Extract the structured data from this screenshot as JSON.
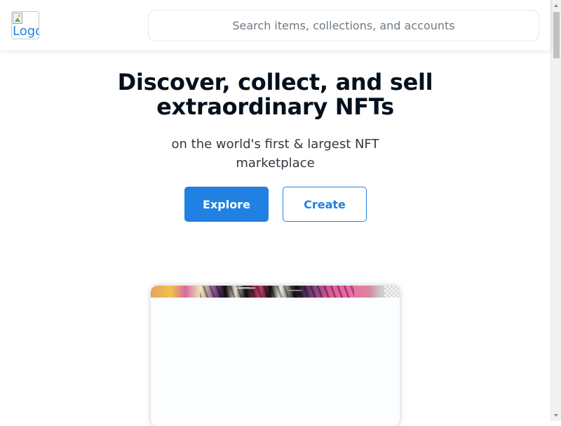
{
  "header": {
    "logo_alt": "Logo",
    "search": {
      "placeholder": "Search items, collections, and accounts",
      "value": ""
    }
  },
  "hero": {
    "headline": "Discover, collect, and sell extraordinary NFTs",
    "subhead": "on the world's first & largest NFT marketplace",
    "explore_label": "Explore",
    "create_label": "Create"
  },
  "colors": {
    "accent": "#2081e2",
    "text_primary": "#04111d",
    "text_secondary": "#353840",
    "placeholder": "#707a83"
  },
  "icons": {
    "logo": "broken-image-icon"
  }
}
